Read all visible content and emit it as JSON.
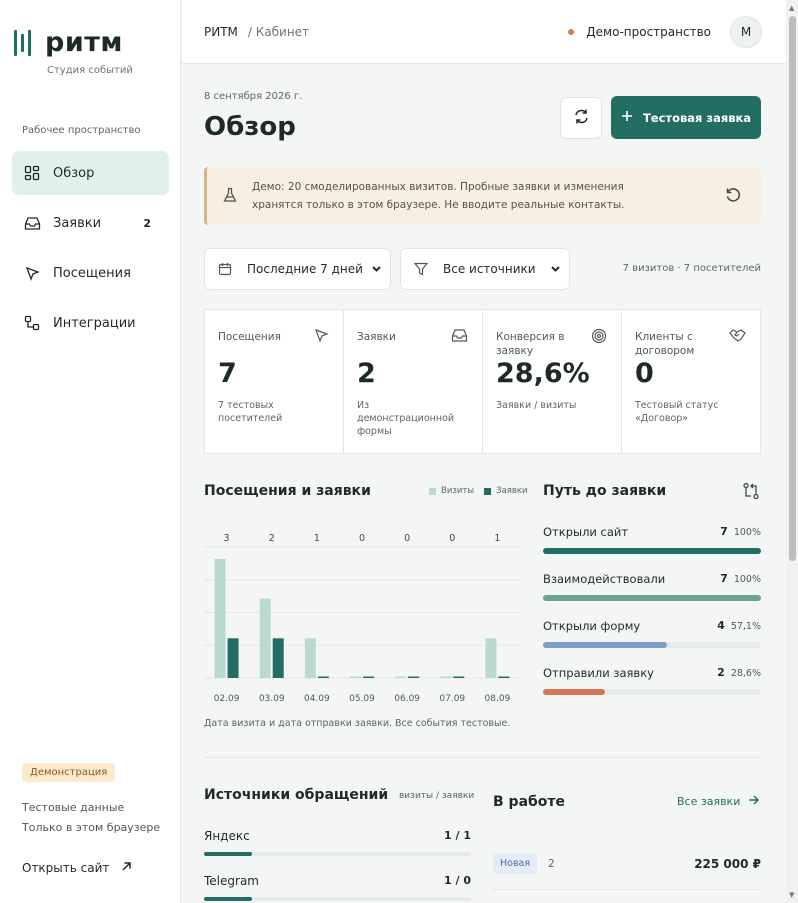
{
  "brand": {
    "name": "ритм",
    "subtitle": "Студия событий",
    "accent": "#226e63"
  },
  "sidebar": {
    "section_label": "Рабочее пространство",
    "items": [
      {
        "label": "Обзор",
        "icon": "dashboard-icon",
        "active": true,
        "count": ""
      },
      {
        "label": "Заявки",
        "icon": "inbox-icon",
        "active": false,
        "count": "2"
      },
      {
        "label": "Посещения",
        "icon": "cursor-icon",
        "active": false,
        "count": ""
      },
      {
        "label": "Интеграции",
        "icon": "integrations-icon",
        "active": false,
        "count": ""
      }
    ],
    "demo_badge": "Демонстрация",
    "note_line1": "Тестовые данные",
    "note_line2": "Только в этом браузере",
    "open_site": "Открыть сайт"
  },
  "topbar": {
    "breadcrumb_root": "РИТМ",
    "breadcrumb_current": "/ Кабинет",
    "space_name": "Демо-пространство",
    "avatar_initial": "М"
  },
  "page": {
    "date": "8 сентября 2026 г.",
    "title": "Обзор",
    "primary_button": "Тестовая заявка"
  },
  "banner": {
    "text": "Демо: 20 смоделированных визитов. Пробные заявки и изменения хранятся только в этом браузере. Не вводите реальные контакты."
  },
  "filters": {
    "period_selected": "Последние 7 дней",
    "source_selected": "Все источники",
    "summary": "7 визитов · 7 посетителей"
  },
  "kpis": [
    {
      "label": "Посещения",
      "value": "7",
      "desc": "7 тестовых посетителей",
      "icon": "cursor-icon"
    },
    {
      "label": "Заявки",
      "value": "2",
      "desc": "Из демонстрационной формы",
      "icon": "inbox-icon"
    },
    {
      "label": "Конверсия в заявку",
      "value": "28,6%",
      "desc": "Заявки / визиты",
      "icon": "target-icon"
    },
    {
      "label": "Клиенты с договором",
      "value": "0",
      "desc": "Тестовый статус «Договор»",
      "icon": "handshake-icon"
    }
  ],
  "visits_chart": {
    "title": "Посещения и заявки",
    "legend_visits": "Визиты",
    "legend_requests": "Заявки",
    "note": "Дата визита и дата отправки заявки. Все события тестовые."
  },
  "chart_data": {
    "type": "bar",
    "categories": [
      "02.09",
      "03.09",
      "04.09",
      "05.09",
      "06.09",
      "07.09",
      "08.09"
    ],
    "series": [
      {
        "name": "Визиты",
        "values": [
          3,
          2,
          1,
          0,
          0,
          0,
          1
        ],
        "color": "#b9d9d1"
      },
      {
        "name": "Заявки",
        "values": [
          1,
          1,
          0,
          0,
          0,
          0,
          0
        ],
        "color": "#226e63"
      }
    ],
    "data_labels": [
      "3",
      "2",
      "1",
      "0",
      "0",
      "0",
      "1"
    ],
    "ylim": [
      0,
      3.3
    ],
    "grid": true
  },
  "funnel": {
    "title": "Путь до заявки",
    "rows": [
      {
        "label": "Открыли сайт",
        "value": "7",
        "pct": "100%",
        "fraction": 1.0,
        "color": "#226e63"
      },
      {
        "label": "Взаимодействовали",
        "value": "7",
        "pct": "100%",
        "fraction": 1.0,
        "color": "#6aa396"
      },
      {
        "label": "Открыли форму",
        "value": "4",
        "pct": "57,1%",
        "fraction": 0.571,
        "color": "#7f9ec4"
      },
      {
        "label": "Отправили заявку",
        "value": "2",
        "pct": "28,6%",
        "fraction": 0.286,
        "color": "#d9765a"
      }
    ]
  },
  "sources": {
    "title": "Источники обращений",
    "hint": "визиты / заявки",
    "rows": [
      {
        "label": "Яндекс",
        "value": "1 / 1",
        "fraction": 0.18
      },
      {
        "label": "Telegram",
        "value": "1 / 0",
        "fraction": 0.18
      }
    ]
  },
  "in_work": {
    "title": "В работе",
    "all_link": "Все заявки",
    "rows": [
      {
        "status": "Новая",
        "number": "2",
        "amount": "225 000 ₽"
      }
    ]
  }
}
